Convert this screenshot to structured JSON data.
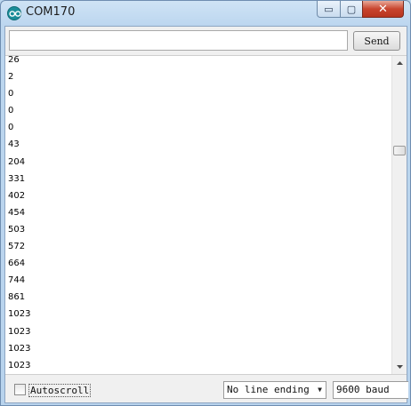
{
  "window": {
    "title": "COM170",
    "controls": {
      "minimize": "▭",
      "maximize": "▢",
      "close": "✕"
    }
  },
  "send_bar": {
    "input_value": "",
    "send_label": "Send"
  },
  "output": {
    "lines": [
      "26",
      "2",
      "0",
      "0",
      "0",
      "43",
      "204",
      "331",
      "402",
      "454",
      "503",
      "572",
      "664",
      "744",
      "861",
      "1023",
      "1023",
      "1023",
      "1023"
    ],
    "scroll_position": 0.27
  },
  "footer": {
    "autoscroll_label": "Autoscroll",
    "autoscroll_checked": false,
    "line_ending": {
      "selected": "No line ending"
    },
    "baud": {
      "selected": "9600 baud"
    }
  },
  "icons": {
    "app": "arduino-icon",
    "scroll_up": "scroll-up-arrow-icon",
    "scroll_down": "scroll-down-arrow-icon",
    "dropdown": "chevron-down-icon"
  }
}
